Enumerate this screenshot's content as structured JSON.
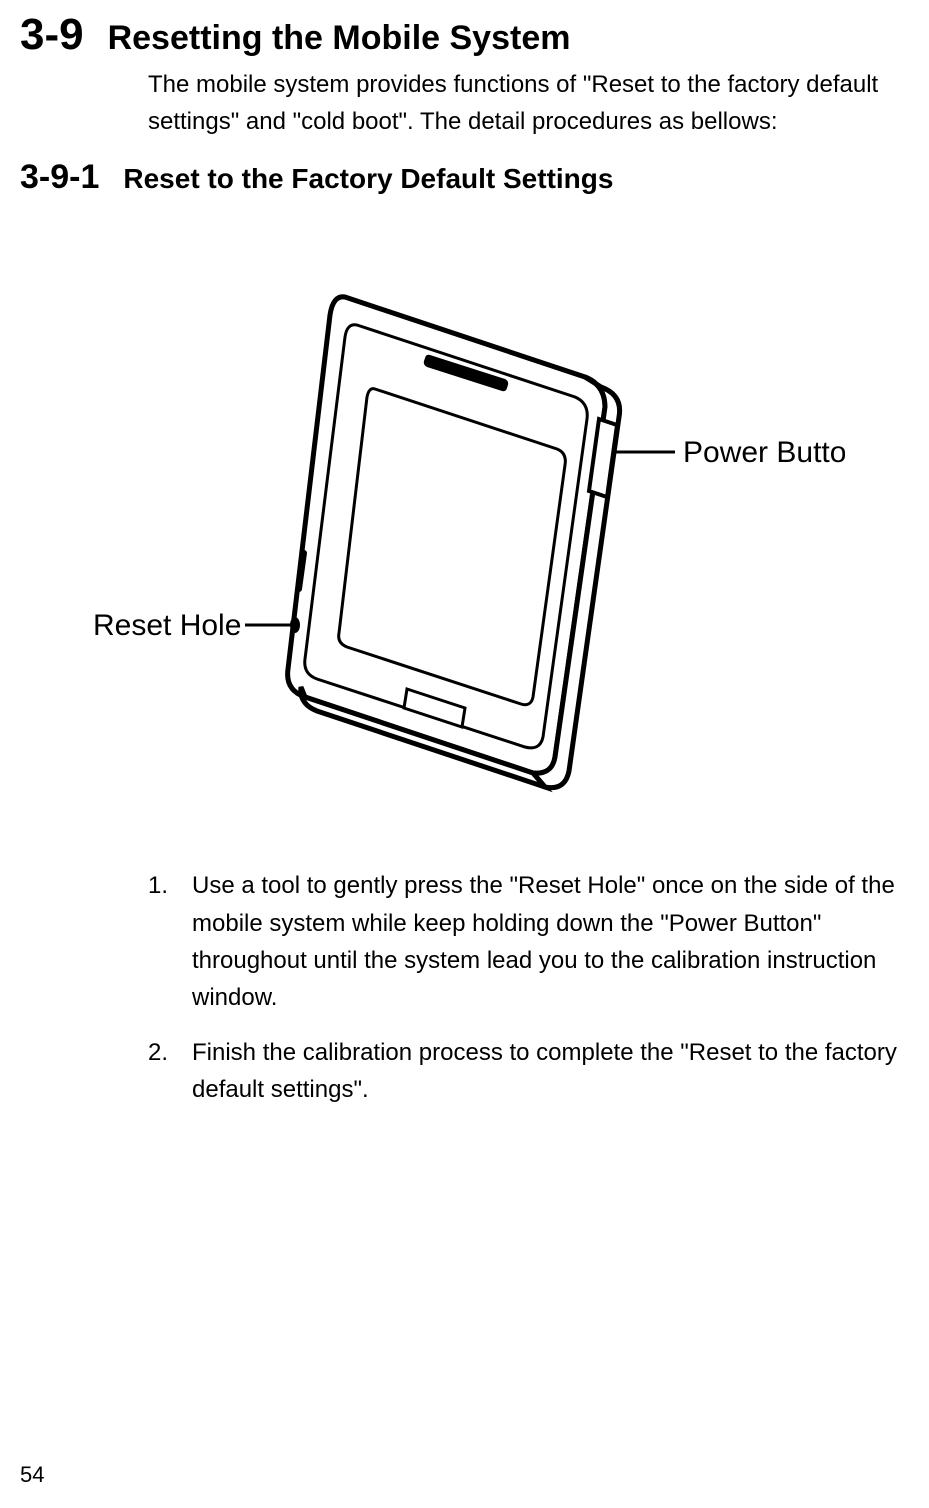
{
  "section": {
    "number": "3-9",
    "title": "Resetting the Mobile System",
    "intro": "The mobile system provides functions of \"Reset to the factory default settings\" and \"cold boot\". The detail procedures as bellows:"
  },
  "subsection": {
    "number": "3-9-1",
    "title": "Reset to the Factory Default Settings"
  },
  "figure": {
    "label_power": "Power Button",
    "label_reset": "Reset Hole"
  },
  "steps": [
    {
      "n": "1.",
      "text": "Use a tool to gently press the \"Reset Hole\" once on the side of the mobile system while keep holding down the \"Power Button\" throughout until the system lead you to the calibration instruction window."
    },
    {
      "n": "2.",
      "text": "Finish the calibration process to complete the \"Reset to the factory default settings\"."
    }
  ],
  "page_number": "54"
}
